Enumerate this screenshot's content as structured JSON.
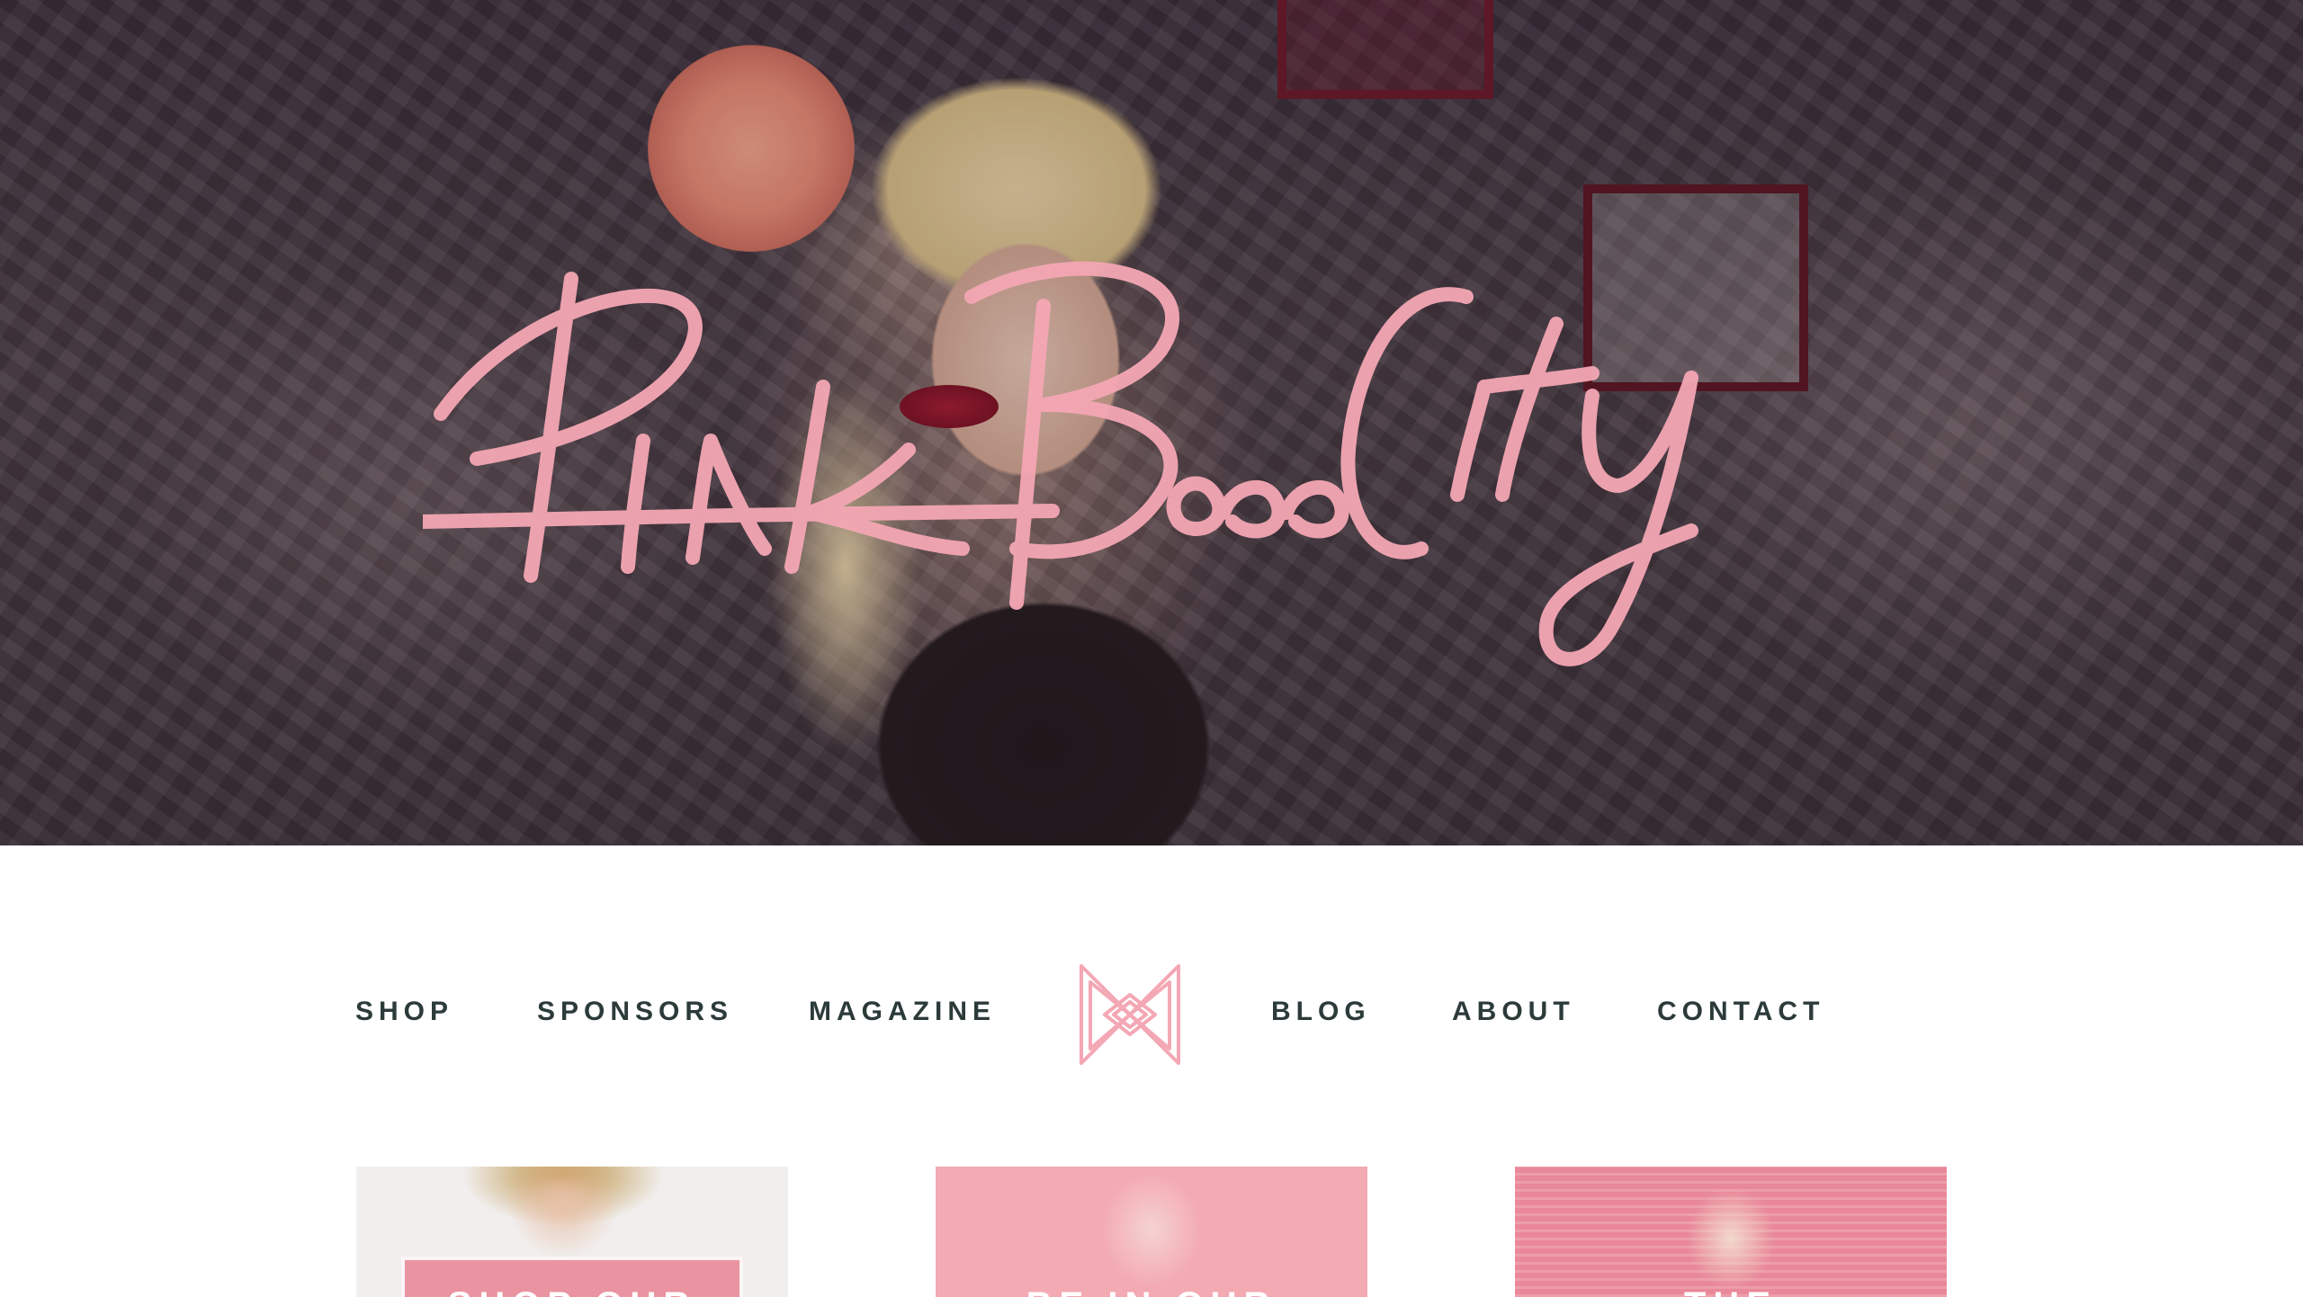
{
  "hero": {
    "logo_text": "Pink Bow City",
    "logo_color": "#f4a7b4"
  },
  "nav": {
    "items": [
      {
        "label": "SHOP"
      },
      {
        "label": "SPONSORS"
      },
      {
        "label": "MAGAZINE"
      },
      {
        "label": "BLOG"
      },
      {
        "label": "ABOUT"
      },
      {
        "label": "CONTACT"
      }
    ],
    "emblem": "bow-emblem-icon",
    "text_color": "#2c3b3a",
    "accent_color": "#f4a7b4"
  },
  "cards": [
    {
      "label": "SHOP OUR"
    },
    {
      "label": "BE IN OUR"
    },
    {
      "label": "THE"
    }
  ]
}
